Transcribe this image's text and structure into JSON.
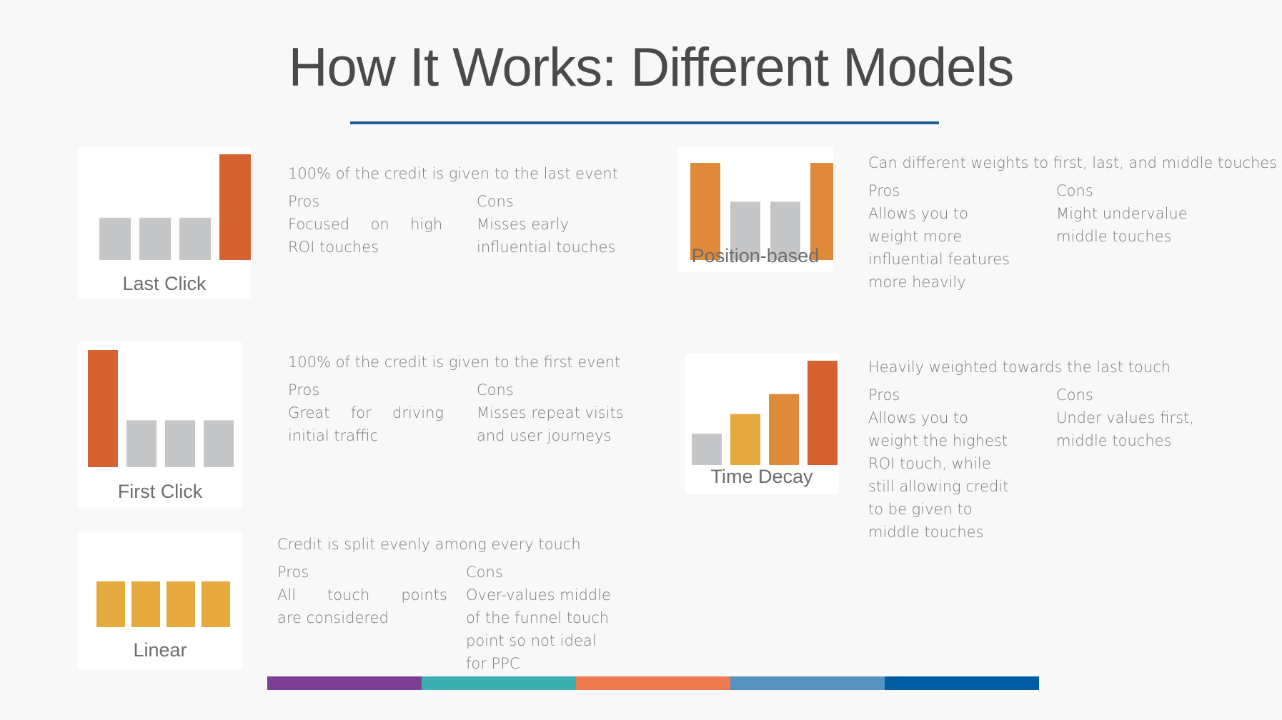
{
  "title": "How It Works: Different Models",
  "colors": {
    "title_rule": "#1f5f99",
    "gray": "#c4c6c8",
    "dark_orange": "#d5622f",
    "orange": "#de8a3a",
    "amber": "#e6a93e"
  },
  "models": [
    {
      "id": "last-click",
      "label": "Last Click",
      "summary": "100% of the credit is given to the last event",
      "pros_heading": "Pros",
      "cons_heading": "Cons",
      "pros": [
        "Focused  on  high",
        "ROI touches"
      ],
      "cons": [
        "Misses early",
        "influential touches"
      ],
      "bars": [
        {
          "value": 0.4,
          "color": "gray"
        },
        {
          "value": 0.4,
          "color": "gray"
        },
        {
          "value": 0.4,
          "color": "gray"
        },
        {
          "value": 1.0,
          "color": "dark_orange"
        }
      ]
    },
    {
      "id": "position-based",
      "label": "Position-based",
      "summary": "Can different weights to first, last, and middle touches",
      "pros_heading": "Pros",
      "cons_heading": "Cons",
      "pros": [
        "Allows you to",
        "weight more",
        "influential features",
        "more heavily"
      ],
      "cons": [
        "Might undervalue",
        "middle touches"
      ],
      "bars": [
        {
          "value": 1.0,
          "color": "orange"
        },
        {
          "value": 0.6,
          "color": "gray"
        },
        {
          "value": 0.6,
          "color": "gray"
        },
        {
          "value": 1.0,
          "color": "orange"
        }
      ]
    },
    {
      "id": "first-click",
      "label": "First Click",
      "summary": "100% of the credit is given to the first event",
      "pros_heading": "Pros",
      "cons_heading": "Cons",
      "pros": [
        "Great  for  driving",
        "initial traffic"
      ],
      "cons": [
        "Misses repeat visits",
        "and user journeys"
      ],
      "bars": [
        {
          "value": 1.0,
          "color": "dark_orange"
        },
        {
          "value": 0.4,
          "color": "gray"
        },
        {
          "value": 0.4,
          "color": "gray"
        },
        {
          "value": 0.4,
          "color": "gray"
        }
      ]
    },
    {
      "id": "time-decay",
      "label": "Time Decay",
      "summary": "Heavily weighted towards the last touch",
      "pros_heading": "Pros",
      "cons_heading": "Cons",
      "pros": [
        "Allows you to",
        "weight the highest",
        "ROI touch, while",
        "still allowing credit",
        "to be given to",
        "middle touches"
      ],
      "cons": [
        "Under values first,",
        "middle touches"
      ],
      "bars": [
        {
          "value": 0.3,
          "color": "gray"
        },
        {
          "value": 0.49,
          "color": "amber"
        },
        {
          "value": 0.68,
          "color": "orange"
        },
        {
          "value": 1.0,
          "color": "dark_orange"
        }
      ]
    },
    {
      "id": "linear",
      "label": "Linear",
      "summary": "Credit is split evenly among every touch",
      "pros_heading": "Pros",
      "cons_heading": "Cons",
      "pros": [
        "All   touch   points",
        "are considered"
      ],
      "cons": [
        "Over-values middle",
        "of the funnel touch",
        "point so not ideal",
        "for PPC"
      ],
      "bars": [
        {
          "value": 1.0,
          "color": "amber"
        },
        {
          "value": 1.0,
          "color": "amber"
        },
        {
          "value": 1.0,
          "color": "amber"
        },
        {
          "value": 1.0,
          "color": "amber"
        }
      ]
    }
  ],
  "footer_colors": [
    "#7b3f93",
    "#3aafaf",
    "#ee7a50",
    "#5592c0",
    "#005da4"
  ]
}
